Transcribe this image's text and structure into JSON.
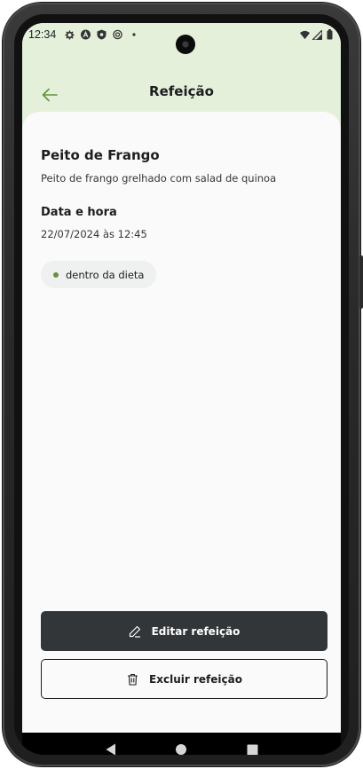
{
  "status_bar": {
    "time": "12:34",
    "left_icons": [
      "settings-icon",
      "a-badge-icon",
      "shield-icon",
      "sync-icon",
      "dot-icon"
    ],
    "right_icons": [
      "wifi-icon",
      "signal-icon",
      "battery-icon"
    ]
  },
  "header": {
    "title": "Refeição",
    "back_icon": "arrow-left-icon"
  },
  "meal": {
    "name": "Peito de Frango",
    "description": "Peito de frango grelhado com salad de quinoa",
    "datetime_label": "Data e hora",
    "datetime_value": "22/07/2024 às 12:45",
    "diet_status": "dentro da dieta"
  },
  "actions": {
    "edit_label": "Editar refeição",
    "edit_icon": "pencil-icon",
    "delete_label": "Excluir refeição",
    "delete_icon": "trash-icon"
  },
  "nav": [
    "back-nav-icon",
    "home-nav-icon",
    "recents-nav-icon"
  ],
  "colors": {
    "header_bg": "#e5f0db",
    "accent_green": "#639339",
    "dark_button": "#333638",
    "content_bg": "#fafafa",
    "chip_bg": "#eff0f0"
  }
}
